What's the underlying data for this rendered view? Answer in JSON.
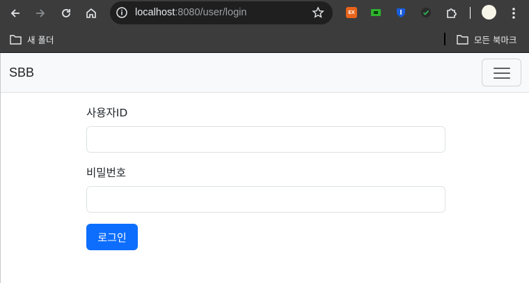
{
  "browser": {
    "url_host": "localhost",
    "url_rest": ":8080/user/login",
    "extensions": [
      {
        "name": "ex-extension",
        "label": "EX",
        "color": "#e8641b"
      },
      {
        "name": "green-extension",
        "label": "",
        "color": "#2db52d"
      },
      {
        "name": "bitwarden-extension",
        "label": "",
        "color": "#175ddc"
      },
      {
        "name": "check-extension",
        "label": "",
        "color": "#1e8e3e"
      }
    ],
    "bookmarks": {
      "left_folder": "새 폴더",
      "right_folder": "모든 북마크"
    }
  },
  "navbar": {
    "brand": "SBB"
  },
  "form": {
    "username_label": "사용자ID",
    "username_value": "",
    "password_label": "비밀번호",
    "password_value": "",
    "submit_label": "로그인"
  },
  "colors": {
    "primary": "#0d6efd",
    "navbar_bg": "#f8f9fa",
    "chrome_bg": "#3c3c3c"
  }
}
